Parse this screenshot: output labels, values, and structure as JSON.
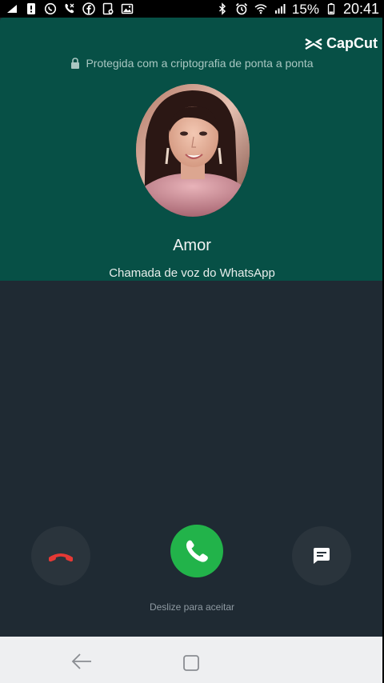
{
  "status_bar": {
    "battery": "15%",
    "time": "20:41",
    "left_icons": [
      "sim-icon",
      "alert-icon",
      "whatsapp-icon",
      "missed-call-icon",
      "facebook-icon",
      "document-icon",
      "image-icon"
    ],
    "right_icons": [
      "bluetooth-icon",
      "alarm-icon",
      "wifi-icon",
      "signal-icon",
      "battery-icon"
    ]
  },
  "watermark": {
    "label": "CapCut"
  },
  "call": {
    "encryption_text": "Protegida com a criptografia de ponta a ponta",
    "caller_name": "Amor",
    "call_type": "Chamada de voz do WhatsApp"
  },
  "actions": {
    "hint": "Deslize para aceitar",
    "decline_icon": "phone-hangup-icon",
    "accept_icon": "phone-icon",
    "message_icon": "message-icon"
  },
  "colors": {
    "header": "#075046",
    "background": "#1f2a33",
    "accept": "#22b34a",
    "decline_icon": "#e53935"
  },
  "navbar": {
    "icons": [
      "back-icon",
      "home-icon"
    ]
  }
}
